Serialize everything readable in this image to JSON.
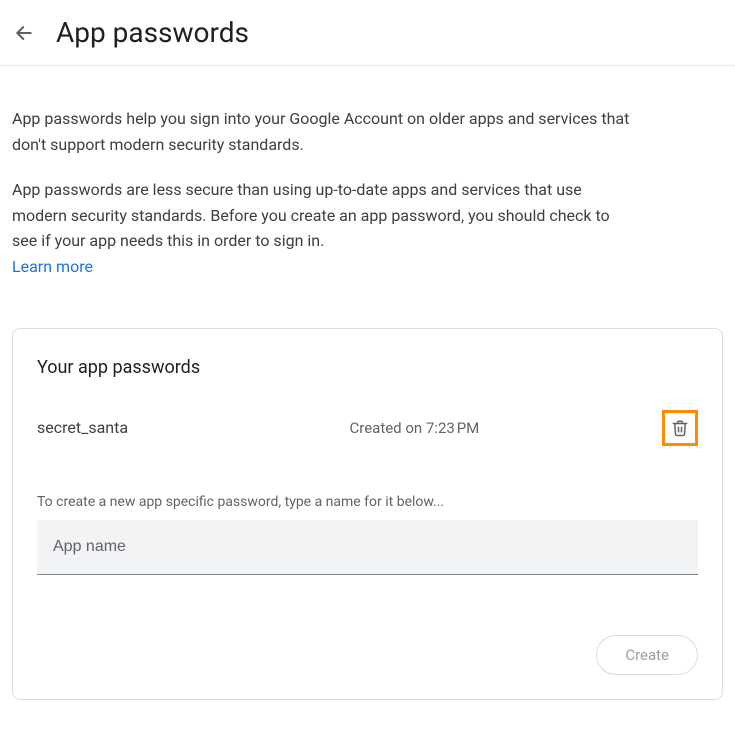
{
  "header": {
    "title": "App passwords"
  },
  "intro": {
    "paragraph1": "App passwords help you sign into your Google Account on older apps and services that don't support modern security standards.",
    "paragraph2": "App passwords are less secure than using up-to-date apps and services that use modern security standards. Before you create an app password, you should check to see if your app needs this in order to sign in.",
    "learn_more": "Learn more"
  },
  "card": {
    "title": "Your app passwords",
    "passwords": [
      {
        "name": "secret_santa",
        "created": "Created on 7:23 PM"
      }
    ],
    "create_help": "To create a new app specific password, type a name for it below...",
    "input_placeholder": "App name",
    "create_label": "Create"
  }
}
